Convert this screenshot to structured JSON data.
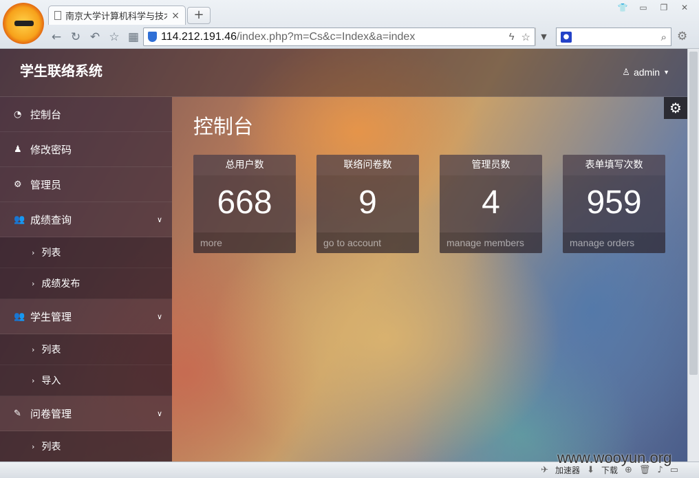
{
  "browser": {
    "tab_title": "南京大学计算机科学与技术",
    "tab_close": "×",
    "new_tab": "+",
    "url_host": "114.212.191.46",
    "url_path": "/index.php?m=Cs&c=Index&a=index",
    "search_placeholder": "",
    "status_items": [
      "加速器",
      "下载"
    ]
  },
  "header": {
    "brand": "学生联络系统",
    "user": "admin"
  },
  "sidebar": {
    "items": [
      {
        "label": "控制台",
        "icon": "dashboard-icon"
      },
      {
        "label": "修改密码",
        "icon": "user-icon"
      },
      {
        "label": "管理员",
        "icon": "cogs-icon"
      },
      {
        "label": "成绩查询",
        "icon": "group-icon",
        "children": [
          "列表",
          "成绩发布"
        ]
      },
      {
        "label": "学生管理",
        "icon": "group-icon",
        "children": [
          "列表",
          "导入"
        ]
      },
      {
        "label": "问卷管理",
        "icon": "edit-icon",
        "children": [
          "列表"
        ]
      }
    ]
  },
  "main": {
    "title": "控制台",
    "cards": [
      {
        "title": "总用户数",
        "value": "668",
        "link": "more"
      },
      {
        "title": "联络问卷数",
        "value": "9",
        "link": "go to account"
      },
      {
        "title": "管理员数",
        "value": "4",
        "link": "manage members"
      },
      {
        "title": "表单填写次数",
        "value": "959",
        "link": "manage orders"
      }
    ]
  },
  "watermark": "www.wooyun.org"
}
